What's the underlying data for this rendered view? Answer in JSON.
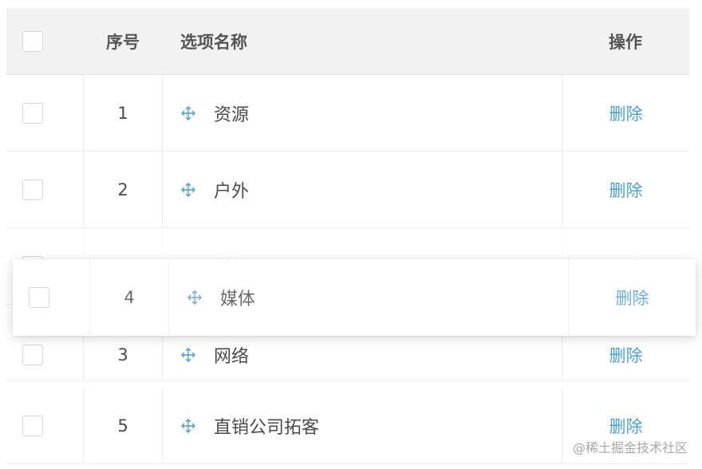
{
  "header": {
    "index_label": "序号",
    "name_label": "选项名称",
    "op_label": "操作"
  },
  "rows": [
    {
      "index": "1",
      "name": "资源",
      "action": "删除"
    },
    {
      "index": "2",
      "name": "户外",
      "action": "删除"
    },
    {
      "index": "4",
      "name": "媒体",
      "action": "删除"
    },
    {
      "index": "3",
      "name": "网络",
      "action": "删除"
    },
    {
      "index": "5",
      "name": "直销公司拓客",
      "action": "删除"
    }
  ],
  "dragging": {
    "index": "4",
    "name": "媒体",
    "action": "删除"
  },
  "watermark": "@稀土掘金技术社区",
  "colors": {
    "link": "#4a9fd9",
    "header_bg": "#f2f2f2",
    "border": "#ececec"
  },
  "icons": {
    "drag_handle": "move-arrows-icon"
  }
}
